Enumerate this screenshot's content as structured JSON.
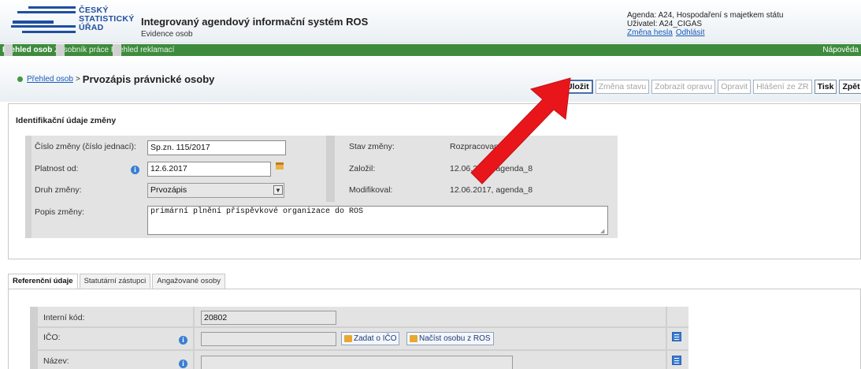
{
  "header": {
    "logo_lines": [
      "ČESKÝ",
      "STATISTICKÝ",
      "ÚŘAD"
    ],
    "app_title": "Integrovaný agendový informační systém ROS",
    "app_subtitle": "Evidence osob",
    "agenda": "Agenda: A24, Hospodaření s majetkem státu",
    "user": "Uživatel: A24_CIGAS",
    "change_password": "Změna hesla",
    "logout": "Odhlásit"
  },
  "nav": {
    "items": [
      "Přehled osob",
      "Zásobník práce",
      "Přehled reklamací"
    ],
    "help": "Nápověda"
  },
  "breadcrumb": {
    "link": "Přehled osob",
    "separator": ">",
    "title": "Prvozápis právnické osoby"
  },
  "toolbar": {
    "buttons": [
      "Uložit",
      "Změna stavu",
      "Zobrazit opravu",
      "Opravit",
      "Hlášení ze ZR",
      "Tisk",
      "Zpět"
    ]
  },
  "change_section": {
    "title": "Identifikační údaje změny",
    "fields": {
      "cislo_label": "Číslo změny (číslo jednací):",
      "cislo_value": "Sp.zn. 115/2017",
      "platnost_label": "Platnost od:",
      "platnost_value": "12.6.2017",
      "druh_label": "Druh změny:",
      "druh_value": "Prvozápis",
      "popis_label": "Popis změny:",
      "popis_value": "primární plnění příspěvkové organizace do ROS",
      "stav_label": "Stav změny:",
      "stav_value": "Rozpracovaná",
      "zalozil_label": "Založil:",
      "zalozil_value": "12.06.2017, agenda_8",
      "modifikoval_label": "Modifikoval:",
      "modifikoval_value": "12.06.2017, agenda_8"
    }
  },
  "tabs": [
    "Referenční údaje",
    "Statutární zástupci",
    "Angažované osoby"
  ],
  "reference": {
    "interni_kod_label": "Interní kód:",
    "interni_kod_value": "20802",
    "ico_label": "IČO:",
    "ico_value": "",
    "zadat_ico_btn": "Zadat o IČO",
    "nacist_btn": "Načíst osobu z ROS",
    "nazev_label": "Název:",
    "nazev_value": ""
  },
  "colors": {
    "nav_green": "#3e8b3e",
    "link_blue": "#1a5ab8",
    "annotation_arrow": "#e8161b",
    "logo_blue": "#1f4ea1"
  },
  "icons": {
    "info": "info-icon",
    "calendar": "calendar-icon",
    "list": "list-icon",
    "dropdown": "chevron-down-icon"
  }
}
